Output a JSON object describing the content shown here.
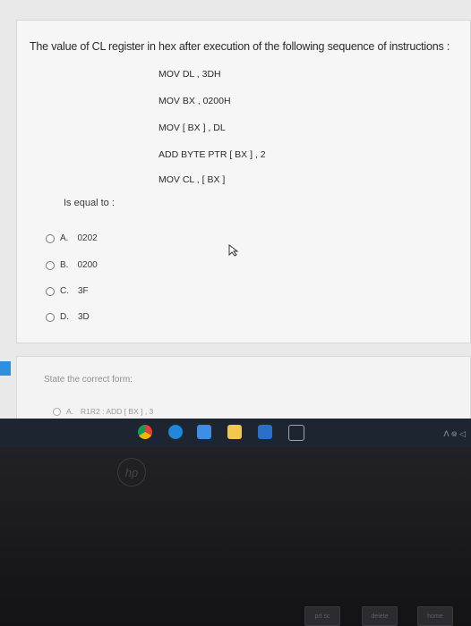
{
  "question": {
    "text": "The value of CL register in hex after execution of the following sequence of instructions :",
    "instructions": [
      "MOV DL , 3DH",
      "MOV BX , 0200H",
      "MOV [ BX ] , DL",
      "ADD BYTE PTR [ BX ] , 2",
      "MOV CL , [ BX ]"
    ],
    "equal_text": "Is equal to :"
  },
  "options": [
    {
      "letter": "A.",
      "value": "0202"
    },
    {
      "letter": "B.",
      "value": "0200"
    },
    {
      "letter": "C.",
      "value": "3F"
    },
    {
      "letter": "D.",
      "value": "3D"
    }
  ],
  "next_question": {
    "text": "State the correct form:",
    "option_a": {
      "letter": "A.",
      "value": "R1R2 : ADD [ BX ] , 3"
    }
  },
  "taskbar": {
    "tray_text": "ᐱ ᪤ ◁"
  },
  "laptop": {
    "logo": "hp",
    "keys": [
      "prt sc",
      "delete",
      "home"
    ]
  },
  "colors": {
    "accent": "#2d8fe0",
    "taskbar": "#1d2530"
  }
}
